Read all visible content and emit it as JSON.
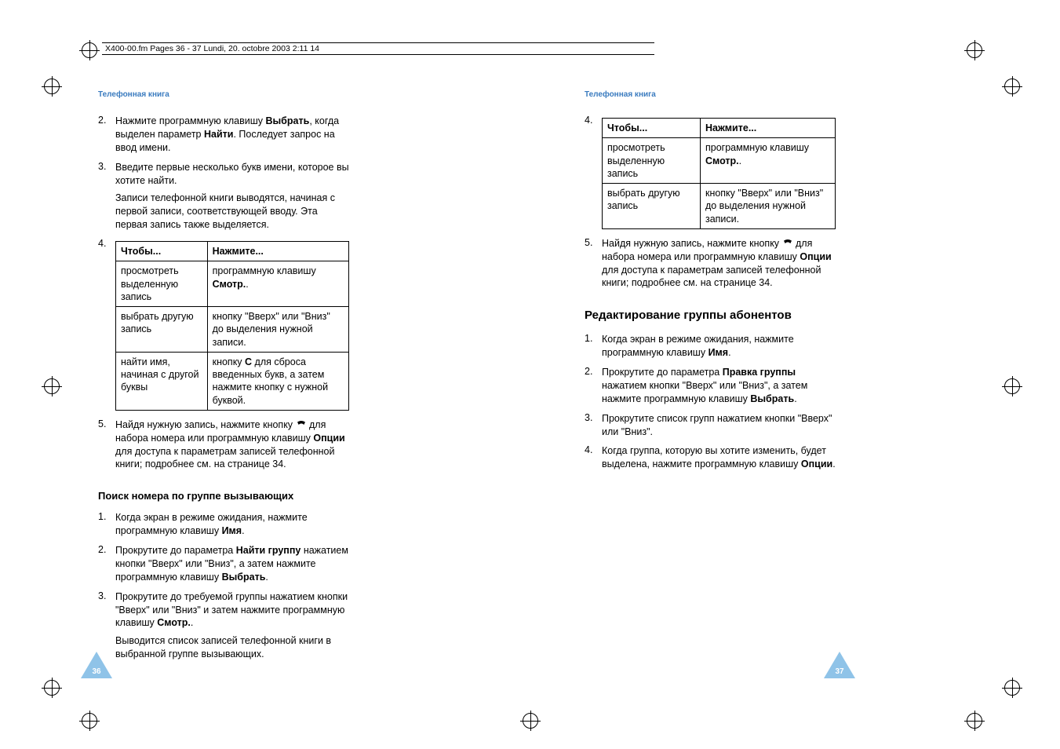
{
  "header_line": "X400-00.fm  Pages 36 - 37  Lundi, 20. octobre 2003  2:11 14",
  "left": {
    "running_head": "Телефонная книга",
    "item2_num": "2.",
    "item2_a": "Нажмите программную клавишу ",
    "item2_b": "Выбрать",
    "item2_c": ", когда выделен параметр ",
    "item2_d": "Найти",
    "item2_e": ". Последует запрос на ввод имени.",
    "item3_num": "3.",
    "item3_a": "Введите первые несколько букв имени, которое вы хотите найти.",
    "item3_p": "Записи телефонной книги выводятся, начиная с первой записи, соответствующей вводу. Эта первая запись также выделяется.",
    "item4_num": "4.",
    "th_to": "Чтобы...",
    "th_press": "Нажмите...",
    "r1c1": "просмотреть выделенную запись",
    "r1c2_a": "программную клавишу ",
    "r1c2_b": "Смотр.",
    "r1c2_c": ".",
    "r2c1": "выбрать другую запись",
    "r2c2": "кнопку \"Вверх\" или \"Вниз\" до выделения нужной записи.",
    "r3c1": "найти имя, начиная с другой буквы",
    "r3c2_a": "кнопку ",
    "r3c2_b": "C",
    "r3c2_c": " для сброса введенных букв, а затем нажмите кнопку с нужной буквой.",
    "item5_num": "5.",
    "item5_a": "Найдя нужную запись, нажмите кнопку ",
    "item5_b": " для набора номера или программную клавишу ",
    "item5_c": "Опции",
    "item5_d": " для доступа к параметрам записей телефонной книги; подробнее см. на странице 34.",
    "sub_heading": "Поиск номера по группе вызывающих",
    "g1_num": "1.",
    "g1_a": "Когда экран в режиме ожидания, нажмите программную клавишу ",
    "g1_b": "Имя",
    "g1_c": ".",
    "g2_num": "2.",
    "g2_a": "Прокрутите до параметра ",
    "g2_b": "Найти группу",
    "g2_c": " нажатием кнопки \"Вверх\" или \"Вниз\", а затем нажмите программную клавишу ",
    "g2_d": "Выбрать",
    "g2_e": ".",
    "g3_num": "3.",
    "g3_a": "Прокрутите до требуемой группы нажатием кнопки \"Вверх\" или \"Вниз\" и затем нажмите программную клавишу ",
    "g3_b": "Смотр.",
    "g3_c": ".",
    "g3_p": "Выводится список записей телефонной книги в выбранной группе вызывающих.",
    "page_num": "36"
  },
  "right": {
    "running_head": "Телефонная книга",
    "item4_num": "4.",
    "th_to": "Чтобы...",
    "th_press": "Нажмите...",
    "r1c1": "просмотреть выделенную запись",
    "r1c2_a": "программную клавишу ",
    "r1c2_b": "Смотр.",
    "r1c2_c": ".",
    "r2c1": "выбрать другую запись",
    "r2c2": "кнопку \"Вверх\" или \"Вниз\" до выделения нужной записи.",
    "item5_num": "5.",
    "item5_a": "Найдя нужную запись, нажмите кнопку ",
    "item5_b": " для набора номера или программную клавишу ",
    "item5_c": "Опции",
    "item5_d": " для доступа к параметрам записей телефонной книги; подробнее см. на странице 34.",
    "section_heading": "Редактирование группы абонентов",
    "e1_num": "1.",
    "e1_a": "Когда экран в режиме ожидания, нажмите программную клавишу ",
    "e1_b": "Имя",
    "e1_c": ".",
    "e2_num": "2.",
    "e2_a": "Прокрутите до параметра ",
    "e2_b": "Правка группы",
    "e2_c": " нажатием кнопки \"Вверх\" или \"Вниз\", а затем нажмите программную клавишу ",
    "e2_d": "Выбрать",
    "e2_e": ".",
    "e3_num": "3.",
    "e3_a": "Прокрутите список групп нажатием кнопки \"Вверх\" или \"Вниз\".",
    "e4_num": "4.",
    "e4_a": "Когда группа, которую вы хотите изменить, будет выделена, нажмите программную клавишу ",
    "e4_b": "Опции",
    "e4_c": ".",
    "page_num": "37"
  }
}
